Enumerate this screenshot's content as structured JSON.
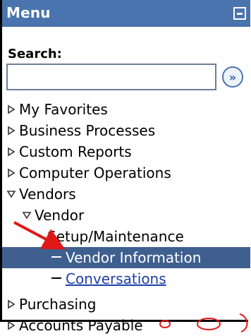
{
  "menu": {
    "title": "Menu",
    "search_label": "Search:",
    "search_value": "",
    "search_placeholder": ""
  },
  "tree": [
    {
      "label": "My Favorites",
      "state": "collapsed",
      "level": 0
    },
    {
      "label": "Business Processes",
      "state": "collapsed",
      "level": 0
    },
    {
      "label": "Custom Reports",
      "state": "collapsed",
      "level": 0
    },
    {
      "label": "Computer Operations",
      "state": "collapsed",
      "level": 0
    },
    {
      "label": "Vendors",
      "state": "expanded",
      "level": 0
    },
    {
      "label": "Vendor",
      "state": "expanded",
      "level": 1
    },
    {
      "label": "Setup/Maintenance",
      "state": "none",
      "level": 2
    },
    {
      "label": "Vendor Information",
      "state": "leaf",
      "level": 3,
      "selected": true
    },
    {
      "label": "Conversations",
      "state": "leaf",
      "level": 3,
      "link": true
    },
    {
      "label": "Purchasing",
      "state": "collapsed",
      "level": 0
    },
    {
      "label": "Accounts Payable",
      "state": "collapsed",
      "level": 0
    }
  ],
  "colors": {
    "title_bar": "#4a74ad",
    "selected_bg": "#3f5f8f",
    "arrow": "#e01818",
    "link": "#1e3fa6"
  }
}
